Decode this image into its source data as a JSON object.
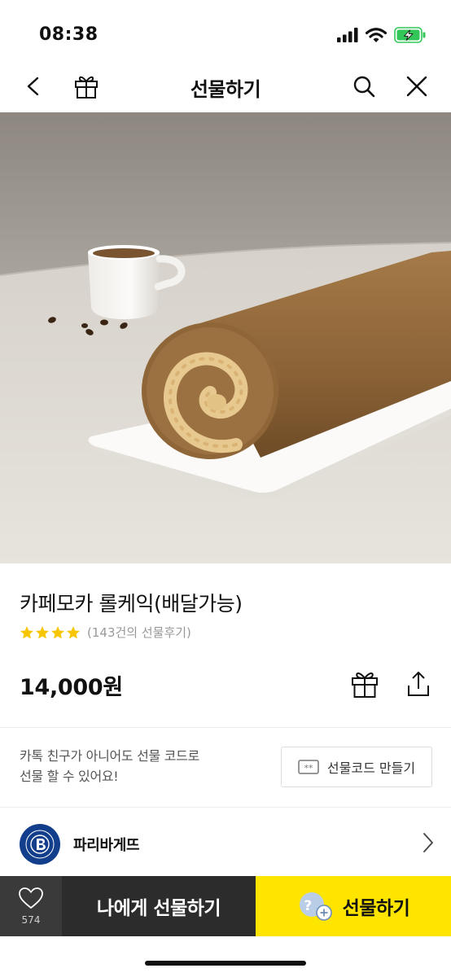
{
  "status_bar": {
    "time": "08:38"
  },
  "nav": {
    "title": "선물하기"
  },
  "product": {
    "name": "카페모카 롤케익(배달가능)",
    "rating": 4,
    "rating_max": 4,
    "review_count_text": "(143건의 선물후기)",
    "price": "14,000원"
  },
  "gift_code": {
    "note_line1": "카톡 친구가 아니어도 선물 코드로",
    "note_line2": "선물 할 수 있어요!",
    "button_label": "선물코드 만들기"
  },
  "brand": {
    "name": "파리바게뜨"
  },
  "bottom_bar": {
    "like_count": "574",
    "gift_me_label": "나에게 선물하기",
    "gift_label": "선물하기"
  },
  "colors": {
    "accent_yellow": "#fee500",
    "star_yellow": "#f7c600",
    "dark_button": "#2c2c2c",
    "brand_blue": "#123e8c"
  },
  "icons": {
    "nav_left": [
      "back-icon",
      "gift-icon"
    ],
    "nav_right": [
      "search-icon",
      "close-icon"
    ],
    "price_actions": [
      "gift-icon",
      "share-icon"
    ],
    "like": "heart-icon"
  }
}
